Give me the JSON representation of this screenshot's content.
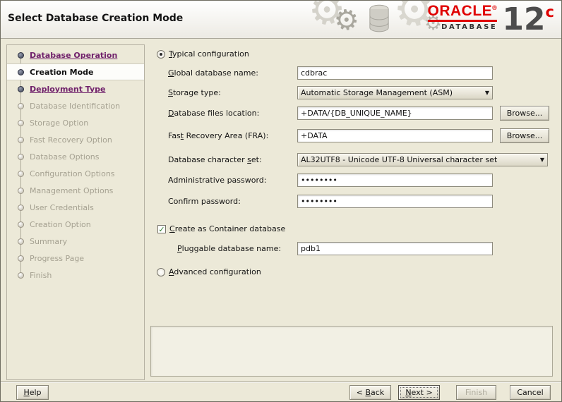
{
  "window": {
    "title": "Select Database Creation Mode"
  },
  "brand": {
    "oracle": "ORACLE",
    "reg": "®",
    "database": "DATABASE",
    "version": "12",
    "version_suffix": "c"
  },
  "icons": {
    "gear": "⚙",
    "dropdown_arrow": "▼",
    "check": "✓"
  },
  "sidebar": {
    "steps": [
      {
        "label": "Database Operation",
        "state": "link"
      },
      {
        "label": "Creation Mode",
        "state": "current"
      },
      {
        "label": "Deployment Type",
        "state": "link"
      },
      {
        "label": "Database Identification",
        "state": "future"
      },
      {
        "label": "Storage Option",
        "state": "future"
      },
      {
        "label": "Fast Recovery Option",
        "state": "future"
      },
      {
        "label": "Database Options",
        "state": "future"
      },
      {
        "label": "Configuration Options",
        "state": "future"
      },
      {
        "label": "Management Options",
        "state": "future"
      },
      {
        "label": "User Credentials",
        "state": "future"
      },
      {
        "label": "Creation Option",
        "state": "future"
      },
      {
        "label": "Summary",
        "state": "future"
      },
      {
        "label": "Progress Page",
        "state": "future"
      },
      {
        "label": "Finish",
        "state": "future"
      }
    ]
  },
  "form": {
    "typical": {
      "text": "Typical configuration",
      "m": 0,
      "selected": true
    },
    "global_name": {
      "label": {
        "text": "Global database name:",
        "m": 0
      },
      "value": "cdbrac"
    },
    "storage_type": {
      "label": {
        "text": "Storage type:",
        "m": 0
      },
      "value": "Automatic Storage Management (ASM)"
    },
    "files_location": {
      "label": {
        "text": "Database files location:",
        "m": 0
      },
      "value": "+DATA/{DB_UNIQUE_NAME}",
      "browse": "Browse..."
    },
    "fra": {
      "label": {
        "text": "Fast Recovery Area (FRA):",
        "m": 3
      },
      "value": "+DATA",
      "browse": "Browse..."
    },
    "charset": {
      "label": {
        "text": "Database character set:",
        "m": 19
      },
      "value": "AL32UTF8 - Unicode UTF-8 Universal character set"
    },
    "admin_pwd": {
      "label": "Administrative password:",
      "value": "••••••••"
    },
    "confirm_pwd": {
      "label": "Confirm password:",
      "value": "••••••••"
    },
    "container": {
      "text": "Create as Container database",
      "m": 0,
      "checked": true
    },
    "pdb_name": {
      "label": {
        "text": "Pluggable database name:",
        "m": 0
      },
      "value": "pdb1"
    },
    "advanced": {
      "text": "Advanced configuration",
      "m": 0,
      "selected": false
    }
  },
  "footer": {
    "help": {
      "text": "Help",
      "m": 0
    },
    "back": {
      "text": "< Back",
      "m": 2
    },
    "next": {
      "text": "Next >",
      "m": 0
    },
    "finish": "Finish",
    "cancel": "Cancel"
  }
}
